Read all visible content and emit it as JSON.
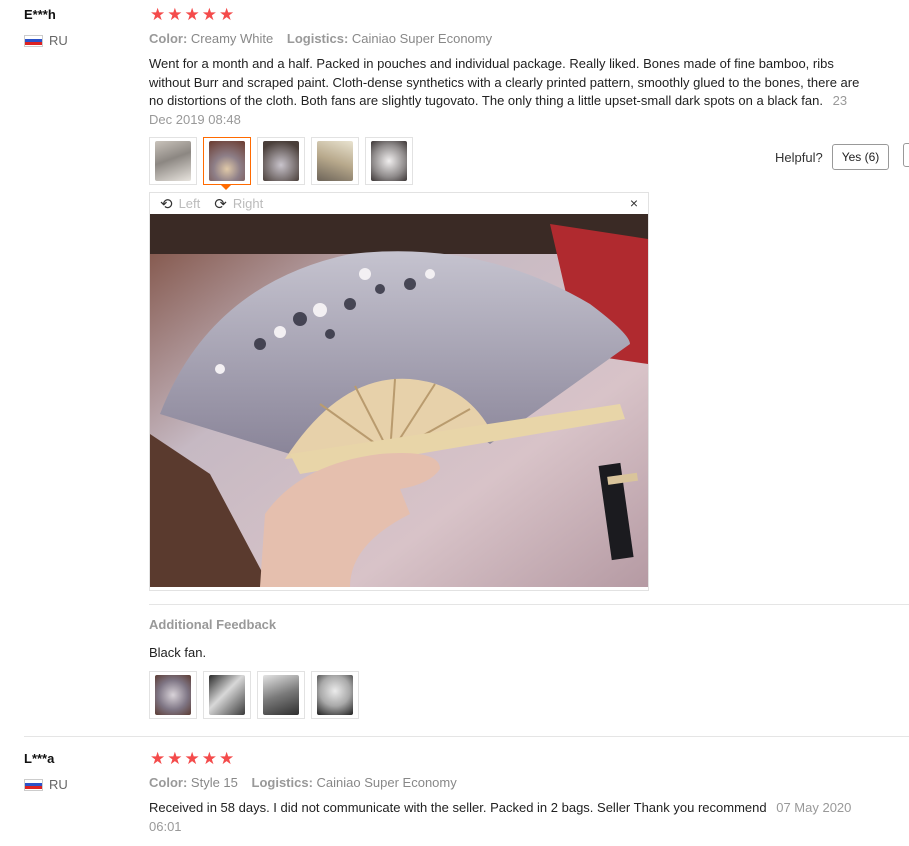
{
  "review1": {
    "user": "E***h",
    "country": "RU",
    "rating": 5,
    "color_label": "Color:",
    "color_value": "Creamy White",
    "logistics_label": "Logistics:",
    "logistics_value": "Cainiao Super Economy",
    "text": "Went for a month and a half. Packed in pouches and individual package. Really liked. Bones made of fine bamboo, ribs without Burr and scraped paint. Cloth-dense synthetics with a clearly printed pattern, smoothly glued to the bones, there are no distortions of the cloth. Both fans are slightly tugovato. The only thing a little upset-small dark spots on a black fan.",
    "date": "23 Dec 2019 08:48",
    "helpful_label": "Helpful?",
    "yes_label": "Yes (6)",
    "viewer": {
      "left": "Left",
      "right": "Right",
      "close": "×"
    },
    "additional_title": "Additional Feedback",
    "additional_text": "Black fan."
  },
  "review2": {
    "user": "L***a",
    "country": "RU",
    "rating": 5,
    "color_label": "Color:",
    "color_value": "Style 15",
    "logistics_label": "Logistics:",
    "logistics_value": "Cainiao Super Economy",
    "text": "Received in 58 days. I did not communicate with the seller. Packed in 2 bags. Seller Thank you recommend",
    "date": "07 May 2020 06:01"
  },
  "colors": {
    "star": "#f44b4b",
    "active_border": "#ff6a00"
  }
}
